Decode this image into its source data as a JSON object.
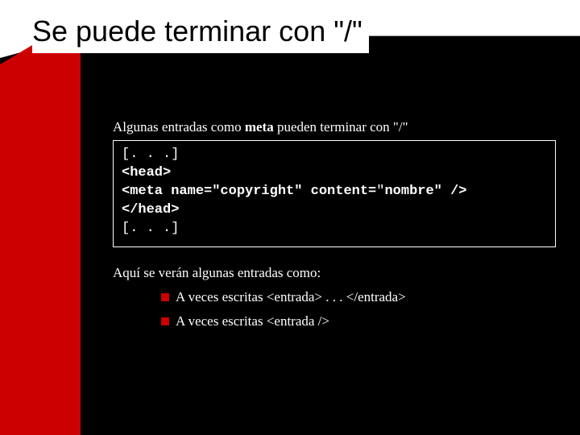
{
  "title": "Se puede terminar con \"/\"",
  "intro_pre": "Algunas entradas como ",
  "intro_bold": "meta",
  "intro_post": " pueden terminar con \"/\"",
  "code": {
    "l1": "[. . .]",
    "l2": " <head>",
    "l3a": "  <meta name=\"copyright\" content=",
    "l3b": "\"",
    "l3c": "nombre\" />",
    "l4": " </head>",
    "l5": "[. . .]"
  },
  "subhead": "Aquí se verán algunas entradas como:",
  "bullets": [
    "A veces escritas <entrada> . . . </entrada>",
    "A veces escritas <entrada />"
  ]
}
